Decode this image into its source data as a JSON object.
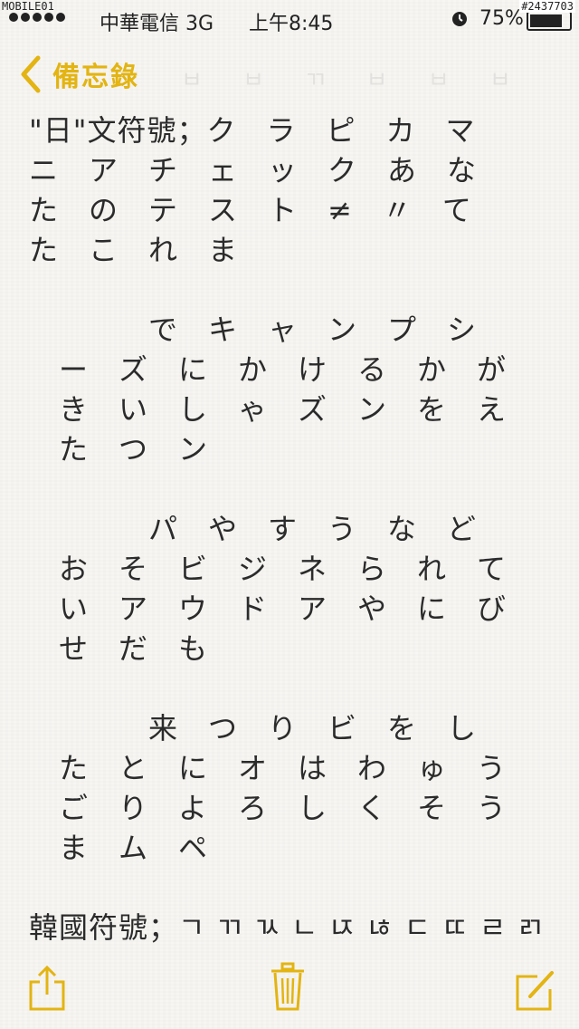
{
  "status_bar": {
    "watermark": "MOBILE01",
    "carrier": "中華電信  3G",
    "time": "上午8:45",
    "battery_percent": "75%",
    "battery_level": 0.75,
    "post_id": "#2437703"
  },
  "nav": {
    "back_label": "備忘錄",
    "accent_color": "#e3b412"
  },
  "note": {
    "paragraphs": [
      "\"日\"文符號；ク　ラ　ピ　カ　マ\nニ　ア　チ　ェ　ッ　ク　あ　な\nた　の　テ　ス　ト　≠　〃　て\nた　こ　れ　ま",
      "　　　　で　キ　ャ　ン　プ　シ\n　ー　ズ　に　か　け　る　か　が\n　き　い　し　ゃ　ズ　ン　を　え\n　た　つ　ン",
      "　　　　パ　や　す　う　な　ど\n　お　そ　ビ　ジ　ネ　ら　れ　て\n　い　ア　ウ　ド　ア　や　に　び\n　せ　だ　も",
      "　　　　来　つ　り　ビ　を　し\n　た　と　に　オ　は　わ　ゅ　う\n　ご　り　よ　ろ　し　く　そ　う\n　ま　ム　ペ",
      "韓國符號；ㄱ ㄲ ㄳ ㄴ ㄵ ㄶ ㄷ ㄸ ㄹ ㄺ"
    ]
  },
  "toolbar": {
    "share_icon": "share-icon",
    "trash_icon": "trash-icon",
    "compose_icon": "compose-icon"
  }
}
